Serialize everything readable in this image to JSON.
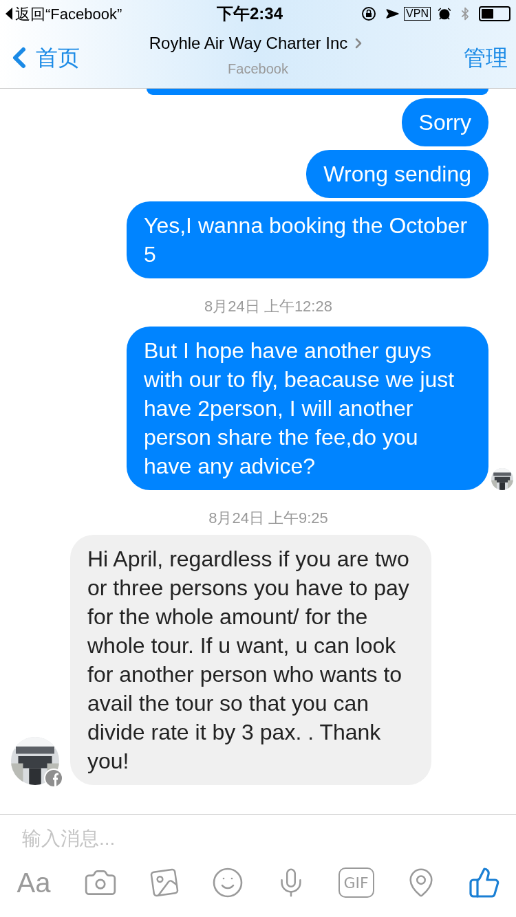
{
  "status_bar": {
    "back_app": "返回“Facebook”",
    "time": "下午2:34",
    "vpn": "VPN"
  },
  "header": {
    "back": "首页",
    "title": "Royhle Air Way Charter Inc",
    "subtitle": "Facebook",
    "action": "管理"
  },
  "messages": [
    {
      "kind": "outgoing",
      "text": "Sorry",
      "avatar": false
    },
    {
      "kind": "outgoing",
      "text": "Wrong sending",
      "avatar": false
    },
    {
      "kind": "outgoing",
      "text": "Yes,I wanna booking the October 5",
      "avatar": false
    },
    {
      "kind": "timestamp",
      "text": "8月24日 上午12:28"
    },
    {
      "kind": "outgoing",
      "text": "But I hope have another guys with our to fly, beacause we just have 2person, I will another person share the fee,do you have any advice?",
      "avatar": true
    },
    {
      "kind": "timestamp",
      "text": "8月24日 上午9:25"
    },
    {
      "kind": "incoming",
      "text": "Hi April, regardless if you are two or three persons you have to pay for the whole amount/ for the whole tour.  If u want, u can look for another person who wants to avail the tour  so that you can divide  rate  it by 3 pax. .  Thank you!",
      "avatar": true
    }
  ],
  "composer": {
    "placeholder": "输入消息...",
    "text_button": "Aa",
    "gif": "GIF"
  }
}
